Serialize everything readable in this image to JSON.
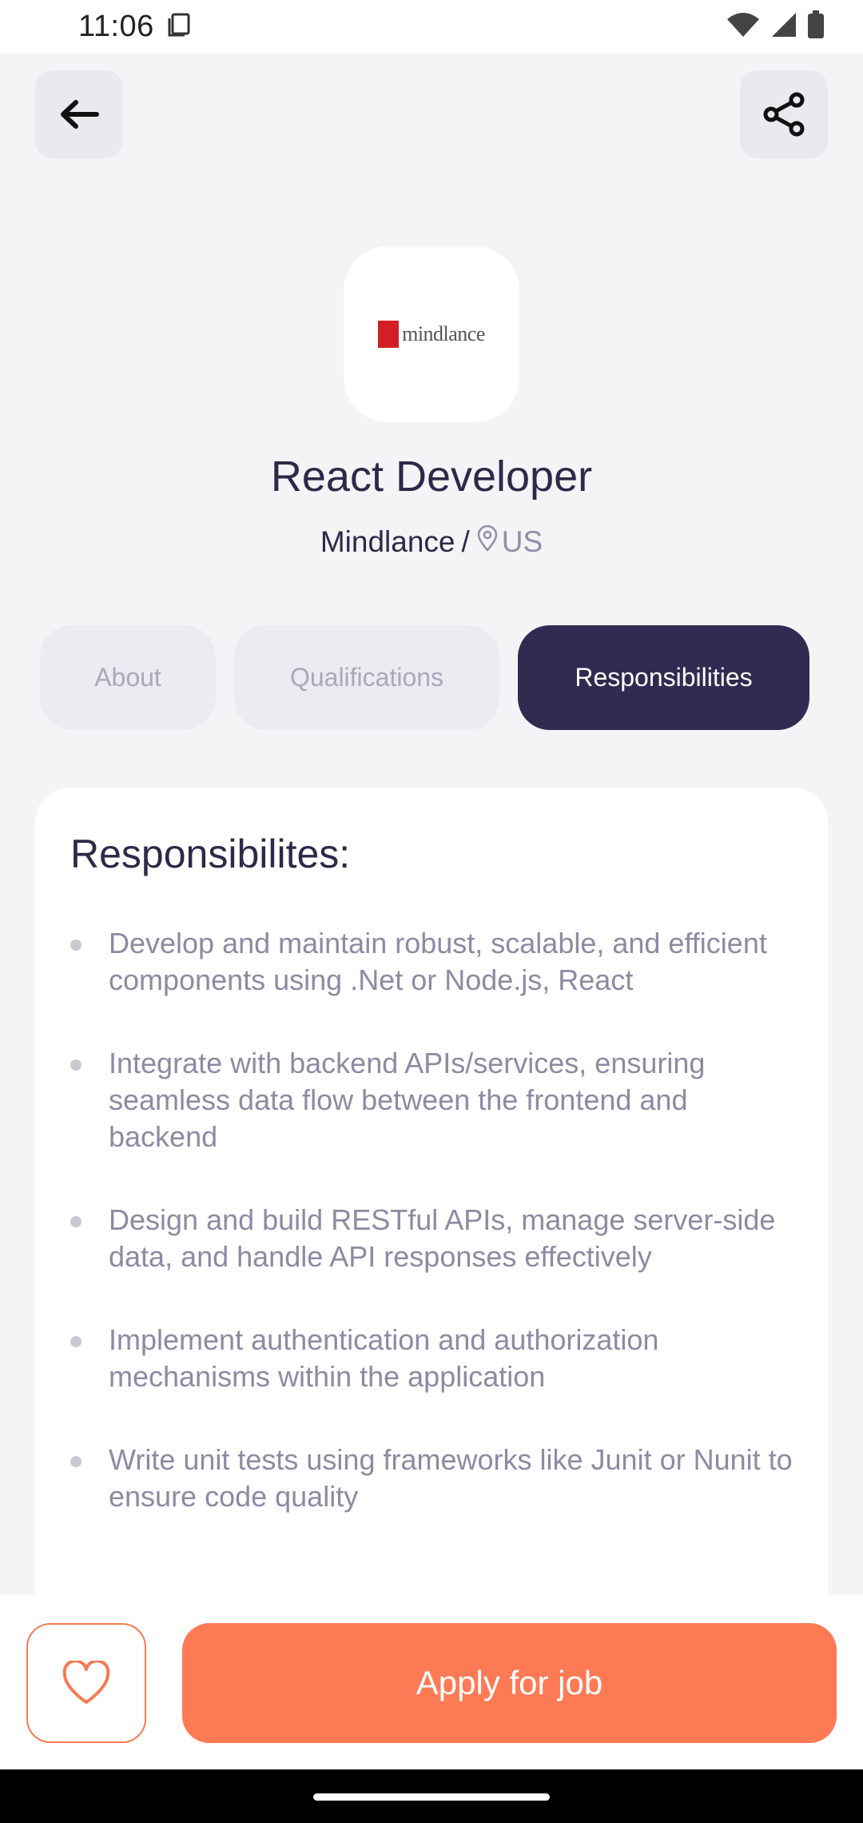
{
  "status_bar": {
    "time": "11:06",
    "icons": [
      "clipboard-icon",
      "wifi-icon",
      "signal-icon",
      "battery-icon"
    ]
  },
  "header": {
    "back_icon": "arrow-left-icon",
    "share_icon": "share-icon"
  },
  "job": {
    "logo_text": "mindlance",
    "title": "React Developer",
    "company": "Mindlance",
    "separator": "/",
    "location": "US",
    "location_icon": "map-pin-icon"
  },
  "tabs": [
    {
      "label": "About",
      "active": false
    },
    {
      "label": "Qualifications",
      "active": false
    },
    {
      "label": "Responsibilities",
      "active": true
    }
  ],
  "responsibilities": {
    "title": "Responsibilites:",
    "items": [
      "Develop and maintain robust, scalable, and efficient components using .Net or Node.js, React",
      "Integrate with backend APIs/services, ensuring seamless data flow between the frontend and backend",
      "Design and build RESTful APIs, manage server-side data, and handle API responses effectively",
      "Implement authentication and authorization mechanisms within the application",
      "Write unit tests using frameworks like Junit or Nunit to ensure code quality"
    ]
  },
  "actions": {
    "like_icon": "heart-icon",
    "apply_label": "Apply for job"
  },
  "colors": {
    "primary_dark": "#332a51",
    "accent": "#fe7a55",
    "text_muted": "#8b8ba3",
    "background": "#f4f4f6"
  }
}
